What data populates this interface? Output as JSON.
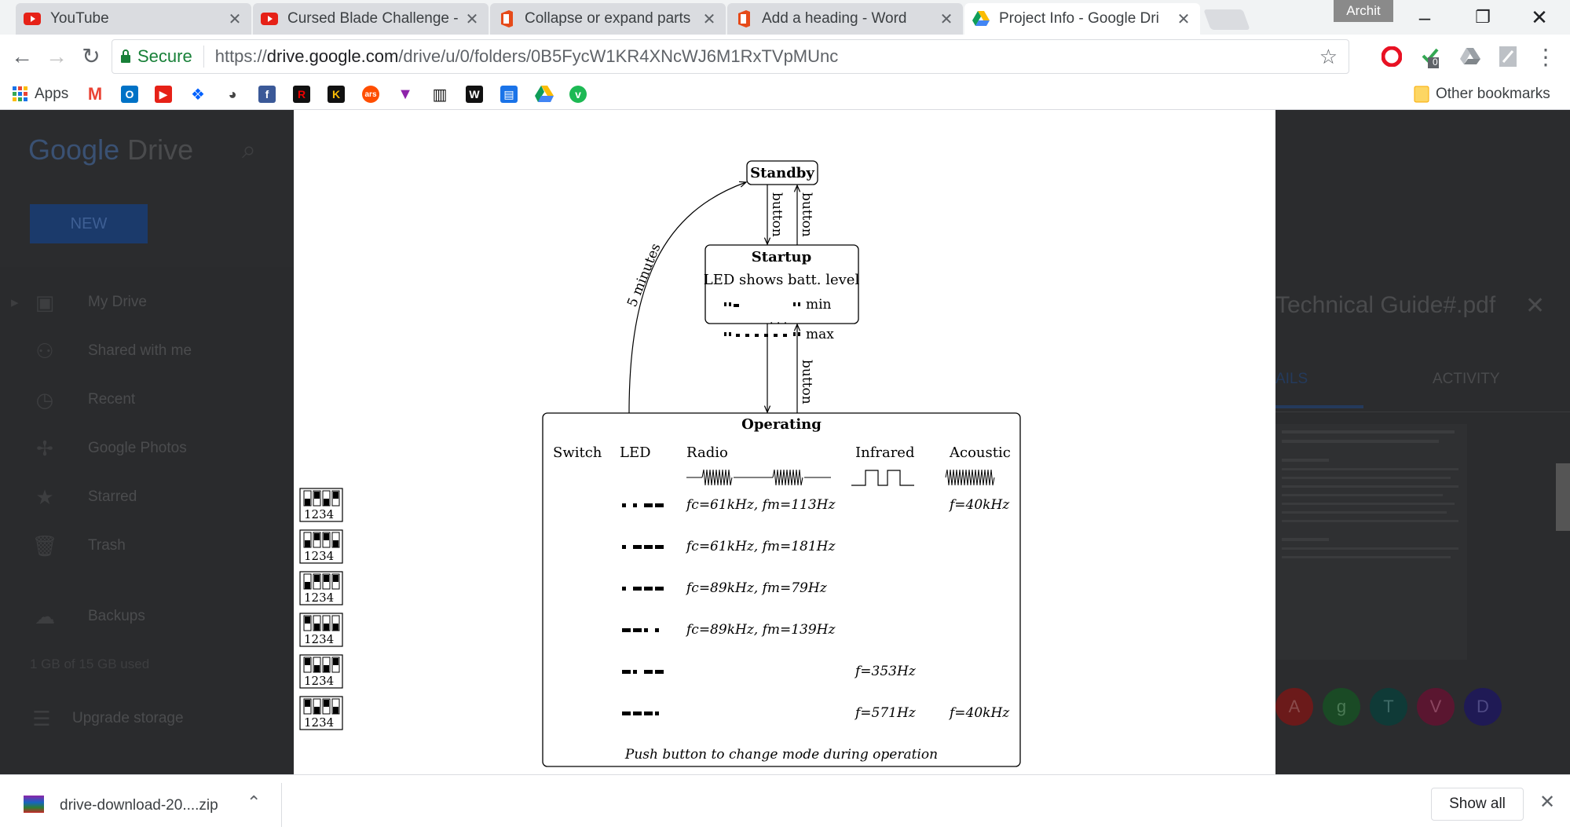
{
  "tabs": [
    {
      "title": "YouTube",
      "icon": "youtube-icon",
      "active": false
    },
    {
      "title": "Cursed Blade Challenge -",
      "icon": "youtube-icon",
      "active": false
    },
    {
      "title": "Collapse or expand parts",
      "icon": "office-icon",
      "active": false
    },
    {
      "title": "Add a heading - Word",
      "icon": "office-icon",
      "active": false
    },
    {
      "title": "Project Info - Google Dri",
      "icon": "google-drive-icon",
      "active": true
    }
  ],
  "window": {
    "profile": "Archit"
  },
  "omnibox": {
    "secure_label": "Secure",
    "url_scheme": "https://",
    "url_host": "drive.google.com",
    "url_path": "/drive/u/0/folders/0B5FycW1KR4XNcWJ6M1RxTVpMUnc"
  },
  "extensions": {
    "badge": "0"
  },
  "bookmarks": {
    "apps_label": "Apps",
    "other_label": "Other bookmarks"
  },
  "drive": {
    "logo_google": "Google",
    "logo_drive": "Drive",
    "new_label": "NEW",
    "nav": [
      {
        "label": "My Drive",
        "icon": "my-drive-icon"
      },
      {
        "label": "Shared with me",
        "icon": "shared-icon"
      },
      {
        "label": "Recent",
        "icon": "clock-icon"
      },
      {
        "label": "Google Photos",
        "icon": "photos-icon"
      },
      {
        "label": "Starred",
        "icon": "star-icon"
      },
      {
        "label": "Trash",
        "icon": "trash-icon"
      },
      {
        "label": "Backups",
        "icon": "cloud-icon"
      }
    ],
    "storage_text": "1 GB of 15 GB used",
    "upgrade_label": "Upgrade storage",
    "details": {
      "file_title": "Technical Guide#.pdf",
      "tab_details": "AILS",
      "tab_activity": "ACTIVITY",
      "avatars": [
        "A",
        "g",
        "T",
        "V",
        "D"
      ]
    }
  },
  "diagram": {
    "standby": "Standby",
    "startup": "Startup",
    "led_batt": "LED shows batt. level",
    "min": "min",
    "max": "max",
    "ellipsis": ". . .",
    "button": "button",
    "five_min": "5 minutes",
    "operating": "Operating",
    "headers": {
      "switch": "Switch",
      "led": "LED",
      "radio": "Radio",
      "infrared": "Infrared",
      "acoustic": "Acoustic"
    },
    "rows": [
      {
        "radio": "fc=61kHz, fm=113Hz",
        "ir": "",
        "ac": "f=40kHz"
      },
      {
        "radio": "fc=61kHz, fm=181Hz",
        "ir": "",
        "ac": ""
      },
      {
        "radio": "fc=89kHz, fm=79Hz",
        "ir": "",
        "ac": ""
      },
      {
        "radio": "fc=89kHz, fm=139Hz",
        "ir": "",
        "ac": ""
      },
      {
        "radio": "",
        "ir": "f=353Hz",
        "ac": ""
      },
      {
        "radio": "",
        "ir": "f=571Hz",
        "ac": "f=40kHz"
      }
    ],
    "switch_digits": "1234",
    "footer": "Push button to change mode during operation"
  },
  "download": {
    "filename": "drive-download-20....zip",
    "show_all": "Show all"
  }
}
